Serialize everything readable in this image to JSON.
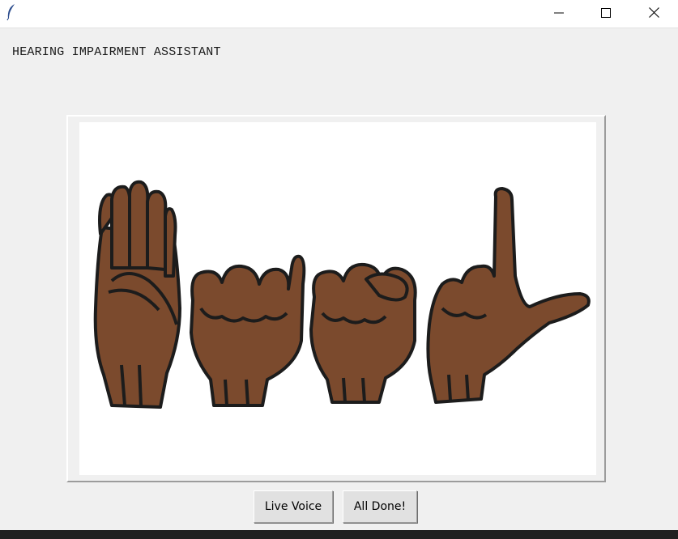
{
  "window": {
    "title": "",
    "icon": "feather-icon",
    "controls": [
      "minimize-icon",
      "maximize-icon",
      "close-icon"
    ]
  },
  "heading": "HEARING IMPAIRMENT ASSISTANT",
  "image": {
    "description_icon": "asl-hands-illustration",
    "skin_color": "#7b4a2d",
    "outline_color": "#1c1c1c"
  },
  "buttons": {
    "live_voice": "Live Voice",
    "all_done": "All Done!"
  }
}
